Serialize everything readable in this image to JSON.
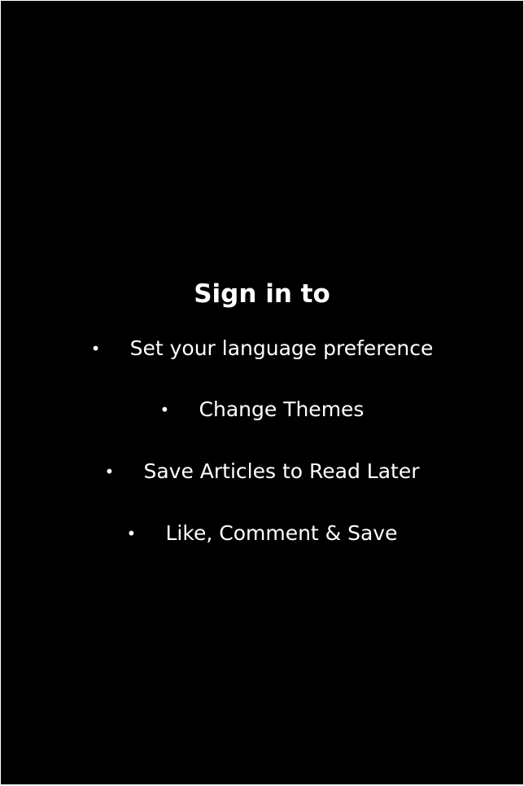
{
  "screen": {
    "heading": "Sign in to",
    "bullet_glyph": "•",
    "benefits": [
      {
        "label": "Set your language preference"
      },
      {
        "label": "Change Themes"
      },
      {
        "label": "Save Articles to Read Later"
      },
      {
        "label": "Like, Comment & Save"
      }
    ]
  },
  "colors": {
    "background": "#000000",
    "text": "#ffffff",
    "frame": "#ffffff"
  }
}
